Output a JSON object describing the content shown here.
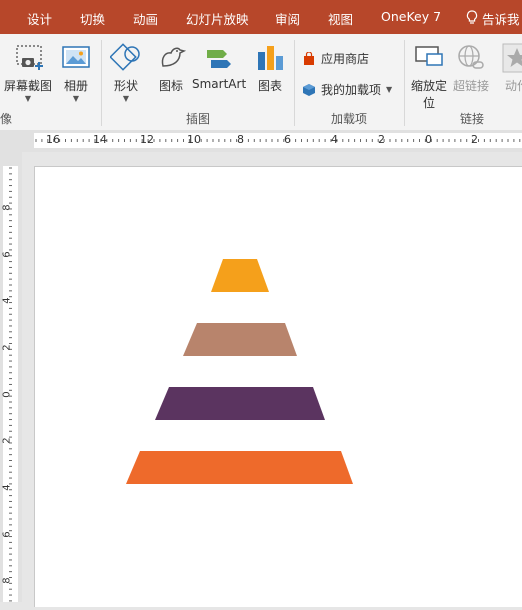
{
  "tabs": [
    "设计",
    "切换",
    "动画",
    "幻灯片放映",
    "审阅",
    "视图",
    "OneKey 7"
  ],
  "tell_me": "告诉我",
  "ribbon": {
    "screenshot_label": "屏幕截图",
    "album_label": "相册",
    "images_group_label": "像",
    "shapes_label": "形状",
    "icons_label": "图标",
    "smartart_label": "SmartArt",
    "chart_label": "图表",
    "illustrations_group_label": "插图",
    "store_label": "应用商店",
    "my_addins_label": "我的加载项",
    "addins_group_label": "加载项",
    "zoom_label_line1": "缩放定",
    "zoom_label_line2": "位",
    "hyperlink_label": "超链接",
    "action_label": "动作",
    "links_group_label": "链接"
  },
  "ruler_h_labels": [
    "16",
    "14",
    "12",
    "10",
    "8",
    "6",
    "4",
    "2",
    "0",
    "2"
  ],
  "ruler_v_labels": [
    "8",
    "6",
    "4",
    "2",
    "0",
    "2",
    "4",
    "6",
    "8"
  ],
  "colors": {
    "accent": "#b7472a",
    "tier1": "#f5a01b",
    "tier2": "#b8846c",
    "tier3": "#5b3460",
    "tier4": "#ee6a2b"
  }
}
